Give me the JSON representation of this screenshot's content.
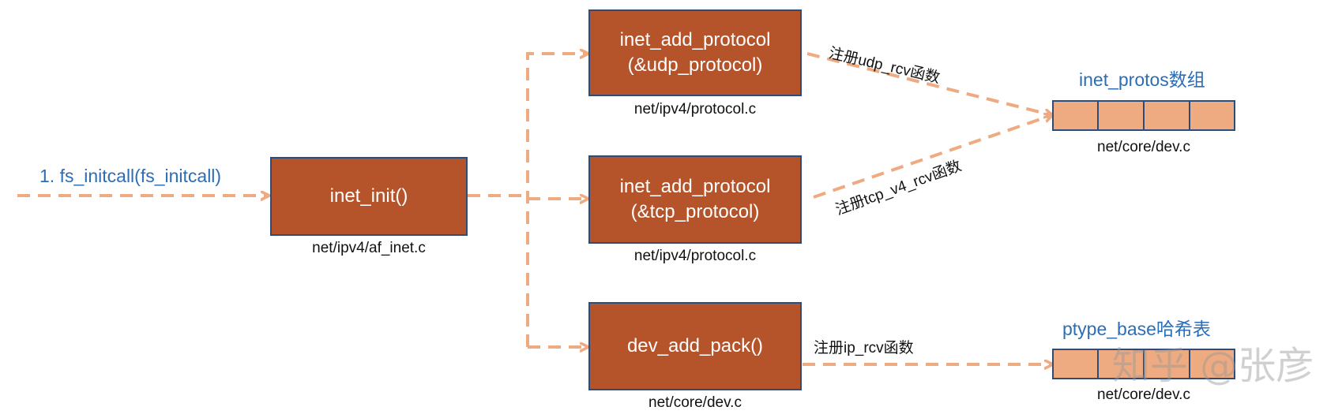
{
  "entry_label": "1. fs_initcall(fs_initcall)",
  "nodes": {
    "inet_init": {
      "label": "inet_init()",
      "file": "net/ipv4/af_inet.c"
    },
    "udp": {
      "line1": "inet_add_protocol",
      "line2": "(&udp_protocol)",
      "file": "net/ipv4/protocol.c"
    },
    "tcp": {
      "line1": "inet_add_protocol",
      "line2": "(&tcp_protocol)",
      "file": "net/ipv4/protocol.c"
    },
    "dev": {
      "label": "dev_add_pack()",
      "file": "net/core/dev.c"
    }
  },
  "edge_labels": {
    "udp": "注册udp_rcv函数",
    "tcp": "注册tcp_v4_rcv函数",
    "ip": "注册ip_rcv函数"
  },
  "targets": {
    "inet_protos": {
      "title": "inet_protos数组",
      "file": "net/core/dev.c"
    },
    "ptype_base": {
      "title": "ptype_base哈希表",
      "file": "net/core/dev.c"
    }
  },
  "watermark": "知乎 @张彦",
  "colors": {
    "box_fill": "#b5532a",
    "box_border": "#2c4d7a",
    "arrow": "#eeab82",
    "title_blue": "#2d6db5",
    "cell_fill": "#eeab82"
  }
}
